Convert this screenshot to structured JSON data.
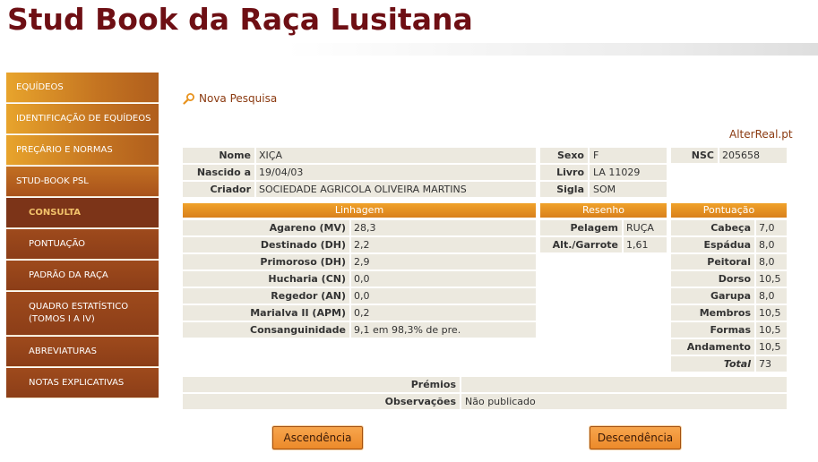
{
  "site": {
    "title": "Stud Book da Raça Lusitana"
  },
  "nav": [
    {
      "label": "EQUÍDEOS"
    },
    {
      "label": "IDENTIFICAÇÃO DE EQUÍDEOS"
    },
    {
      "label": "PREÇÁRIO E NORMAS"
    },
    {
      "label": "STUD-BOOK PSL"
    },
    {
      "label": "CONSULTA"
    },
    {
      "label": "PONTUAÇÃO"
    },
    {
      "label": "PADRÃO DA RAÇA"
    },
    {
      "label": "QUADRO ESTATÍSTICO (TOMOS I A IV)"
    },
    {
      "label": "ABREVIATURAS"
    },
    {
      "label": "NOTAS EXPLICATIVAS"
    }
  ],
  "search": {
    "new_search": "Nova Pesquisa"
  },
  "brand_link": "AlterReal.pt",
  "horse": {
    "nome_label": "Nome",
    "nome": "XIÇA",
    "nascido_label": "Nascido a",
    "nascido": "19/04/03",
    "criador_label": "Criador",
    "criador": "SOCIEDADE AGRICOLA OLIVEIRA MARTINS",
    "sexo_label": "Sexo",
    "sexo": "F",
    "livro_label": "Livro",
    "livro": "LA 11029",
    "sigla_label": "Sigla",
    "sigla": "SOM",
    "nsc_label": "NSC",
    "nsc": "205658"
  },
  "linhagem": {
    "header": "Linhagem",
    "rows": [
      {
        "label": "Agareno (MV)",
        "value": "28,3"
      },
      {
        "label": "Destinado (DH)",
        "value": "2,2"
      },
      {
        "label": "Primoroso (DH)",
        "value": "2,9"
      },
      {
        "label": "Hucharia (CN)",
        "value": "0,0"
      },
      {
        "label": "Regedor (AN)",
        "value": "0,0"
      },
      {
        "label": "Marialva II (APM)",
        "value": "0,2"
      },
      {
        "label": "Consanguinidade",
        "value": "9,1 em 98,3% de pre."
      }
    ]
  },
  "resenho": {
    "header": "Resenho",
    "rows": [
      {
        "label": "Pelagem",
        "value": "RUÇA"
      },
      {
        "label": "Alt./Garrote",
        "value": "1,61"
      }
    ]
  },
  "pontuacao": {
    "header": "Pontuação",
    "rows": [
      {
        "label": "Cabeça",
        "value": "7,0"
      },
      {
        "label": "Espádua",
        "value": "8,0"
      },
      {
        "label": "Peitoral",
        "value": "8,0"
      },
      {
        "label": "Dorso",
        "value": "10,5"
      },
      {
        "label": "Garupa",
        "value": "8,0"
      },
      {
        "label": "Membros",
        "value": "10,5"
      },
      {
        "label": "Formas",
        "value": "10,5"
      },
      {
        "label": "Andamento",
        "value": "10,5"
      },
      {
        "label": "Total",
        "value": "73"
      }
    ]
  },
  "extra": {
    "premios_label": "Prémios",
    "premios": "",
    "observacoes_label": "Observações",
    "observacoes": "Não publicado"
  },
  "buttons": {
    "ascendencia": "Ascendência",
    "descendencia": "Descendência"
  }
}
